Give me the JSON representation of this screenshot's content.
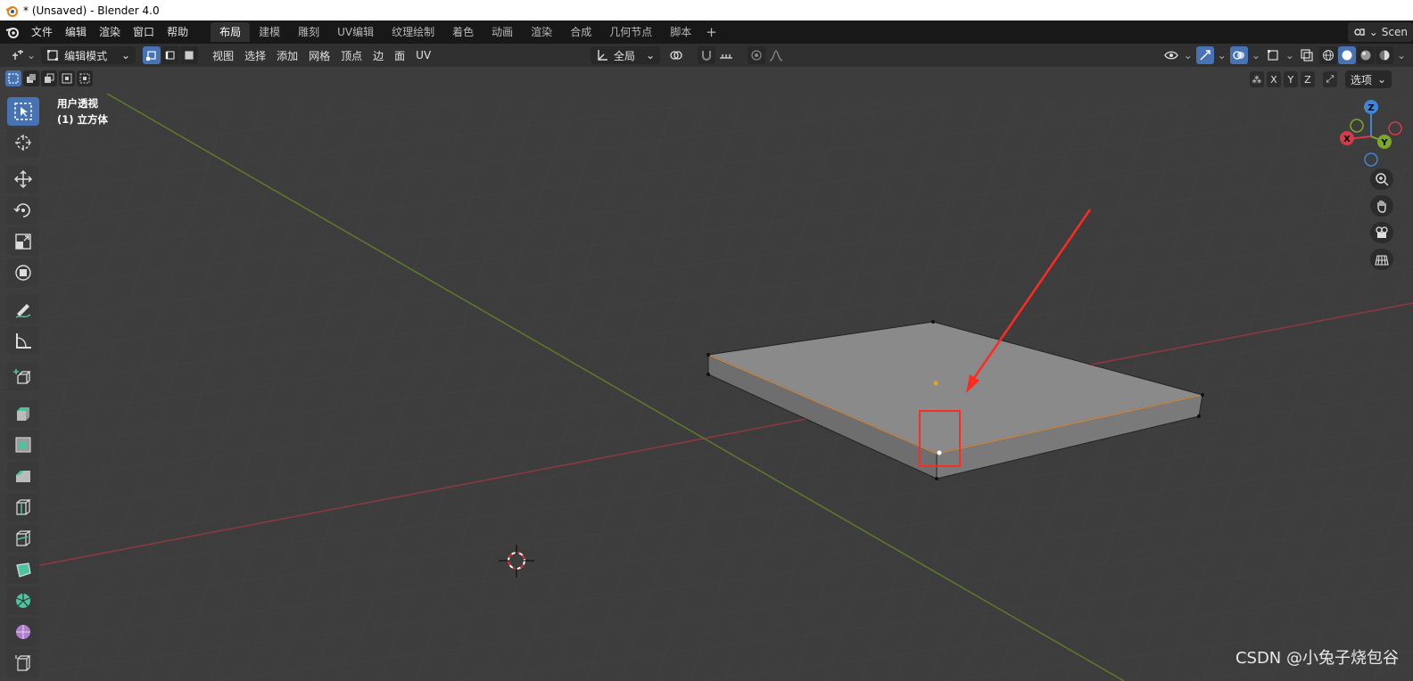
{
  "window": {
    "title": "* (Unsaved) - Blender 4.0"
  },
  "menu": [
    "文件",
    "编辑",
    "渲染",
    "窗口",
    "帮助"
  ],
  "workspaces": [
    {
      "label": "布局",
      "active": true
    },
    {
      "label": "建模"
    },
    {
      "label": "雕刻"
    },
    {
      "label": "UV编辑"
    },
    {
      "label": "纹理绘制"
    },
    {
      "label": "着色"
    },
    {
      "label": "动画"
    },
    {
      "label": "渲染"
    },
    {
      "label": "合成"
    },
    {
      "label": "几何节点"
    },
    {
      "label": "脚本"
    }
  ],
  "scene_label": "Scen",
  "header": {
    "mode": "编辑模式",
    "menus": [
      "视图",
      "选择",
      "添加",
      "网格",
      "顶点",
      "边",
      "面",
      "UV"
    ],
    "transform_orientation": "全局",
    "options_label": "选项",
    "axes": [
      "X",
      "Y",
      "Z"
    ]
  },
  "viewport": {
    "view_name": "用户透视",
    "object_name": "(1) 立方体",
    "gizmo_axes": [
      "X",
      "Y",
      "Z"
    ]
  },
  "toolbar_icons": [
    "select-box-icon",
    "cursor-icon",
    "move-icon",
    "rotate-icon",
    "scale-icon",
    "transform-icon",
    "annotate-icon",
    "measure-icon",
    "add-cube-icon",
    "extrude-icon",
    "inset-icon",
    "bevel-icon",
    "loop-cut-icon",
    "knife-icon",
    "poly-build-icon",
    "spin-icon",
    "smooth-icon",
    "edge-slide-icon"
  ],
  "colors": {
    "x_axis": "#d33c4a",
    "y_axis": "#7aa82a",
    "z_axis": "#3f86d6",
    "selection": "#ff3b2f",
    "active_blue": "#4772b3"
  },
  "watermark": "CSDN @小兔子烧包谷"
}
